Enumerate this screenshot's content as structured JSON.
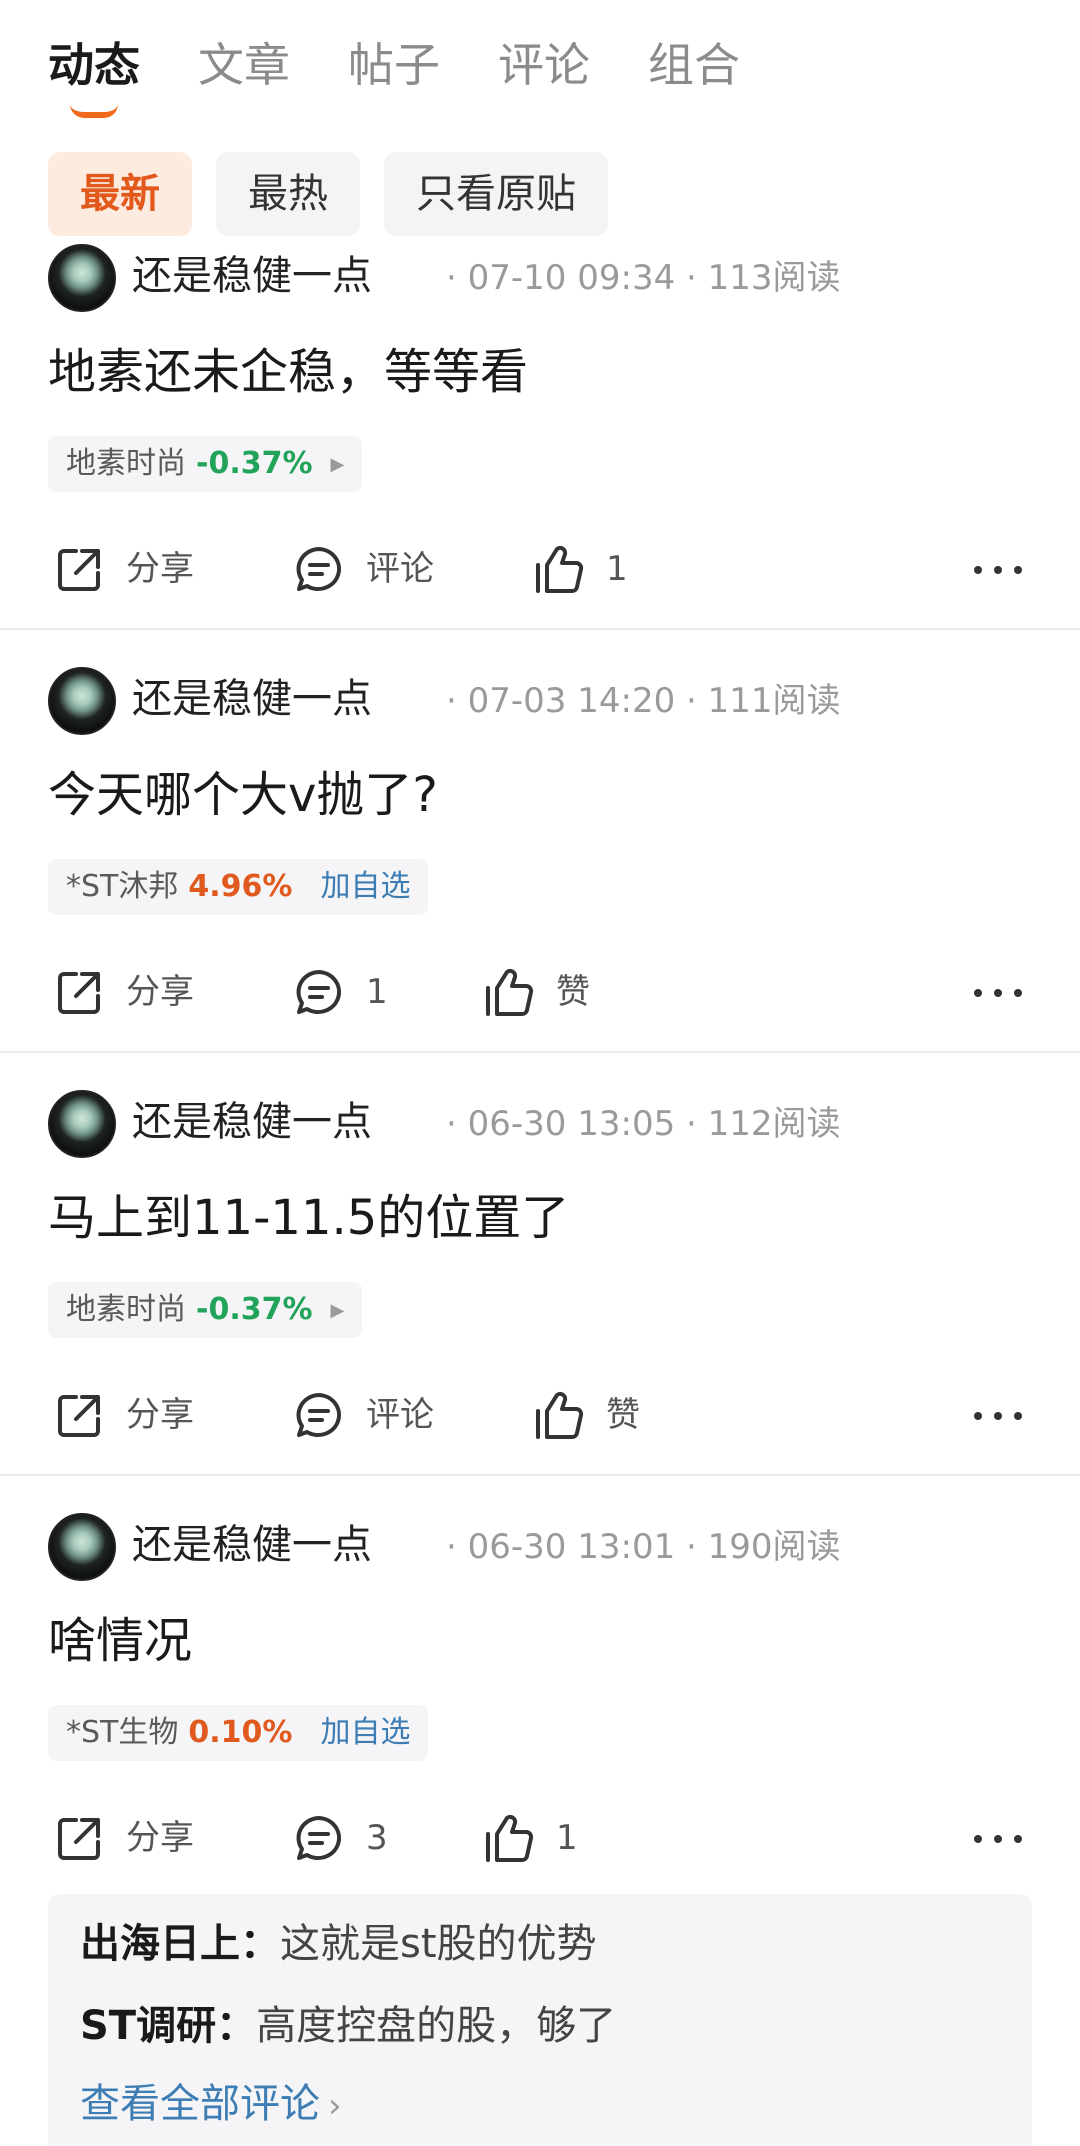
{
  "tabs": [
    {
      "label": "动态",
      "active": true
    },
    {
      "label": "文章",
      "active": false
    },
    {
      "label": "帖子",
      "active": false
    },
    {
      "label": "评论",
      "active": false
    },
    {
      "label": "组合",
      "active": false
    }
  ],
  "filters": [
    {
      "label": "最新",
      "active": true
    },
    {
      "label": "最热",
      "active": false
    },
    {
      "label": "只看原贴",
      "active": false
    }
  ],
  "posts": [
    {
      "author": "还是稳健一点",
      "meta": "· 07-10 09:34 · 113阅读",
      "text": "地素还未企稳，等等看",
      "stock": {
        "name": "地素时尚",
        "change": "-0.37%",
        "direction": "down",
        "watch": ""
      },
      "actions": {
        "share": "分享",
        "comment": "评论",
        "like": "1"
      }
    },
    {
      "author": "还是稳健一点",
      "meta": "· 07-03 14:20 · 111阅读",
      "text": "今天哪个大v抛了?",
      "stock": {
        "name": "*ST沐邦",
        "change": "4.96%",
        "direction": "up",
        "watch": "加自选"
      },
      "actions": {
        "share": "分享",
        "comment": "1",
        "like": "赞"
      }
    },
    {
      "author": "还是稳健一点",
      "meta": "· 06-30 13:05 · 112阅读",
      "text": "马上到11-11.5的位置了",
      "stock": {
        "name": "地素时尚",
        "change": "-0.37%",
        "direction": "down",
        "watch": ""
      },
      "actions": {
        "share": "分享",
        "comment": "评论",
        "like": "赞"
      }
    },
    {
      "author": "还是稳健一点",
      "meta": "· 06-30 13:01 · 190阅读",
      "text": "啥情况",
      "stock": {
        "name": "*ST生物",
        "change": "0.10%",
        "direction": "up",
        "watch": "加自选"
      },
      "actions": {
        "share": "分享",
        "comment": "3",
        "like": "1"
      }
    }
  ],
  "comments": [
    {
      "user": "出海日上：",
      "text": "这就是st股的优势"
    },
    {
      "user": "ST调研：",
      "text": "高度控盘的股，够了"
    }
  ],
  "see_all_comments": "查看全部评论",
  "colors": {
    "accent": "#f26b1d",
    "down": "#22a35a",
    "up": "#e05a1f",
    "link": "#3d7db3"
  }
}
